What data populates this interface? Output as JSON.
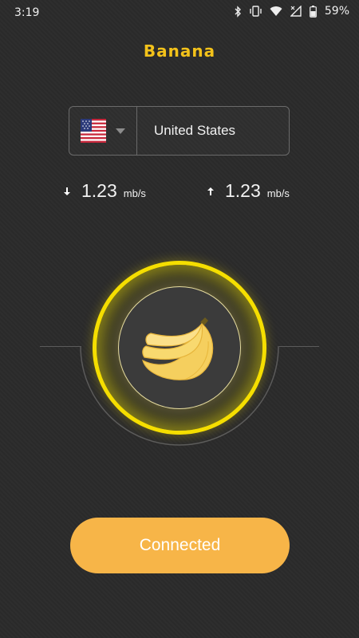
{
  "status_bar": {
    "time": "3:19",
    "battery_percent": "59%"
  },
  "app": {
    "title": "Banana",
    "accent_color": "#f3c21a"
  },
  "server": {
    "country": "United States",
    "flag_icon": "us-flag-icon"
  },
  "speeds": {
    "download": {
      "value": "1.23",
      "unit": "mb/s"
    },
    "upload": {
      "value": "1.23",
      "unit": "mb/s"
    }
  },
  "connect_button": {
    "label": "Connected",
    "color": "#f7b548"
  }
}
